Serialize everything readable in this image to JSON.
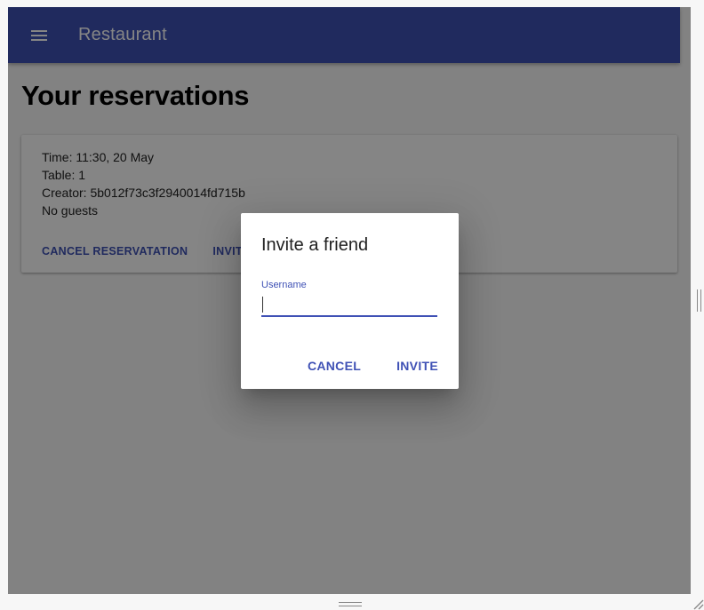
{
  "appbar": {
    "title": "Restaurant",
    "menu_icon": "menu-icon"
  },
  "page": {
    "title": "Your reservations"
  },
  "reservation": {
    "time": "Time: 11:30, 20 May",
    "table": "Table: 1",
    "creator": "Creator: 5b012f73c3f2940014fd715b",
    "guests": "No guests",
    "cancel_label": "CANCEL RESERVATATION",
    "invite_label": "INVITE"
  },
  "dialog": {
    "title": "Invite a friend",
    "field_label": "Username",
    "field_value": "",
    "cancel_label": "CANCEL",
    "invite_label": "INVITE"
  },
  "colors": {
    "primary": "#3f51b5",
    "scrim": "rgba(0,0,0,0.48)"
  }
}
